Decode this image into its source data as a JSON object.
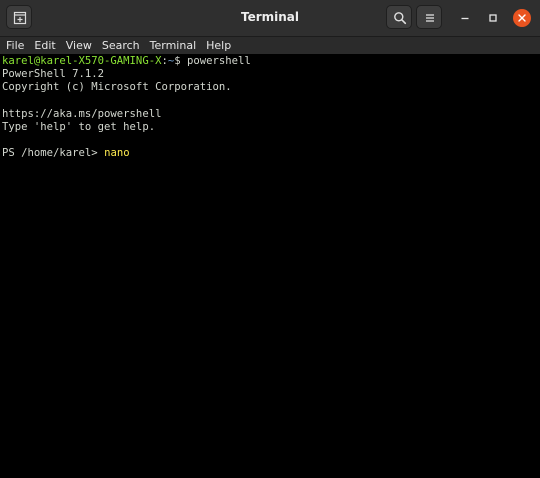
{
  "window": {
    "title": "Terminal"
  },
  "menubar": {
    "items": [
      "File",
      "Edit",
      "View",
      "Search",
      "Terminal",
      "Help"
    ]
  },
  "terminal": {
    "prompt_user_host": "karel@karel-X570-GAMING-X",
    "prompt_sep": ":",
    "prompt_path": "~",
    "prompt_symbol": "$ ",
    "prompt_command": "powershell",
    "lines": [
      "PowerShell 7.1.2",
      "Copyright (c) Microsoft Corporation.",
      "",
      "https://aka.ms/powershell",
      "Type 'help' to get help.",
      ""
    ],
    "ps_prompt": "PS /home/karel> ",
    "ps_command": "nano"
  },
  "colors": {
    "titlebar_bg": "#2f2f2f",
    "terminal_bg": "#000000",
    "terminal_fg": "#d3d7cf",
    "prompt_user": "#8ae234",
    "prompt_path": "#729fcf",
    "ps_command": "#fce94f",
    "close_button": "#e95420"
  },
  "icons": {
    "new_tab": "new-tab-icon",
    "search": "search-icon",
    "menu": "hamburger-menu-icon",
    "minimize": "minimize-icon",
    "maximize": "maximize-icon",
    "close": "close-icon"
  }
}
